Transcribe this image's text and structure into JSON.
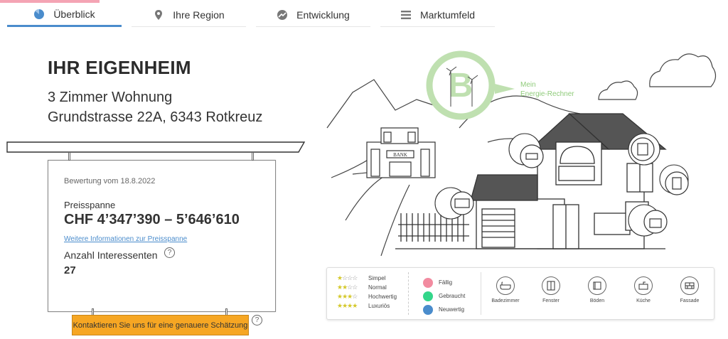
{
  "tabs": [
    {
      "label": "Überblick",
      "icon": "pie-chart-icon",
      "active": true
    },
    {
      "label": "Ihre Region",
      "icon": "map-pin-icon",
      "active": false
    },
    {
      "label": "Entwicklung",
      "icon": "trend-icon",
      "active": false
    },
    {
      "label": "Marktumfeld",
      "icon": "list-icon",
      "active": false
    }
  ],
  "property": {
    "title": "IHR EIGENHEIM",
    "type": "3 Zimmer Wohnung",
    "address": "Grundstrasse 22A, 6343 Rotkreuz"
  },
  "valuation": {
    "date_label": "Bewertung vom 18.8.2022",
    "price_range_label": "Preisspanne",
    "price_range": "CHF 4’347’390 – 5’646’610",
    "more_info_link": "Weitere Informationen zur Preisspanne",
    "interested_label": "Anzahl Interessenten",
    "interested_count": "27",
    "help_glyph": "?"
  },
  "contact_button": "Kontaktieren Sie uns für eine genauere Schätzung",
  "energy": {
    "badge_letter": "B",
    "line1": "Mein",
    "line2": "Energie-Rechner",
    "color": "#bfe0b0"
  },
  "illustration": {
    "bank_sign": "BANK"
  },
  "legend": {
    "quality": [
      {
        "label": "Simpel",
        "filled": 1
      },
      {
        "label": "Normal",
        "filled": 2
      },
      {
        "label": "Hochwertig",
        "filled": 3
      },
      {
        "label": "Luxuriös",
        "filled": 4
      }
    ],
    "status": [
      {
        "label": "Fällig",
        "color": "#f28ba0"
      },
      {
        "label": "Gebraucht",
        "color": "#33d68a"
      },
      {
        "label": "Neuwertig",
        "color": "#4a8ccc"
      }
    ],
    "categories": [
      {
        "label": "Badezimmer",
        "icon": "bathtub-icon"
      },
      {
        "label": "Fenster",
        "icon": "window-icon"
      },
      {
        "label": "Böden",
        "icon": "floor-icon"
      },
      {
        "label": "Küche",
        "icon": "kitchen-icon"
      },
      {
        "label": "Fassade",
        "icon": "brick-wall-icon"
      }
    ]
  },
  "colors": {
    "accent": "#4a8ccc",
    "button": "#f6a623",
    "tab_top_bar": "#f4a4b4"
  }
}
